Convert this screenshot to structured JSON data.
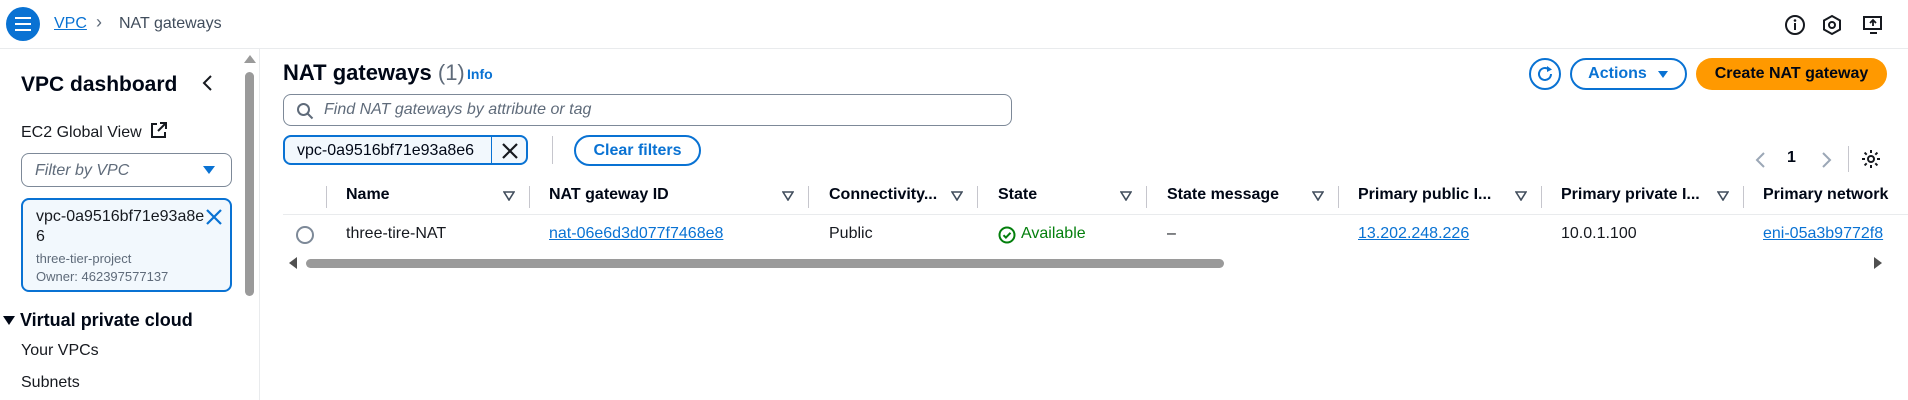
{
  "topbar": {
    "breadcrumbs": [
      "VPC",
      "NAT gateways"
    ],
    "icons": [
      "info-icon",
      "feedback-icon",
      "screen-share-icon"
    ]
  },
  "sidebar": {
    "title": "VPC dashboard",
    "ec2_global_view": "EC2 Global View",
    "filter_placeholder": "Filter by VPC",
    "selected_vpc": {
      "id": "vpc-0a9516bf71e93a8e6",
      "name": "three-tier-project",
      "owner": "Owner: 462397577137"
    },
    "section": "Virtual private cloud",
    "items": [
      "Your VPCs",
      "Subnets"
    ]
  },
  "main": {
    "title": "NAT gateways",
    "count": "(1)",
    "info": "Info",
    "actions_label": "Actions",
    "create_label": "Create NAT gateway",
    "search_placeholder": "Find NAT gateways by attribute or tag",
    "filter_token": "vpc-0a9516bf71e93a8e6",
    "clear_filters": "Clear filters",
    "page": "1",
    "columns": [
      "Name",
      "NAT gateway ID",
      "Connectivity...",
      "State",
      "State message",
      "Primary public I...",
      "Primary private I...",
      "Primary network"
    ],
    "rows": [
      {
        "name": "three-tire-NAT",
        "id": "nat-06e6d3d077f7468e8",
        "connectivity": "Public",
        "state": "Available",
        "state_message": "–",
        "public_ip": "13.202.248.226",
        "private_ip": "10.0.1.100",
        "network": "eni-05a3b9772f8"
      }
    ]
  },
  "colors": {
    "accent": "#0972d3",
    "primary_button": "#ff9900",
    "success": "#037f0c"
  }
}
